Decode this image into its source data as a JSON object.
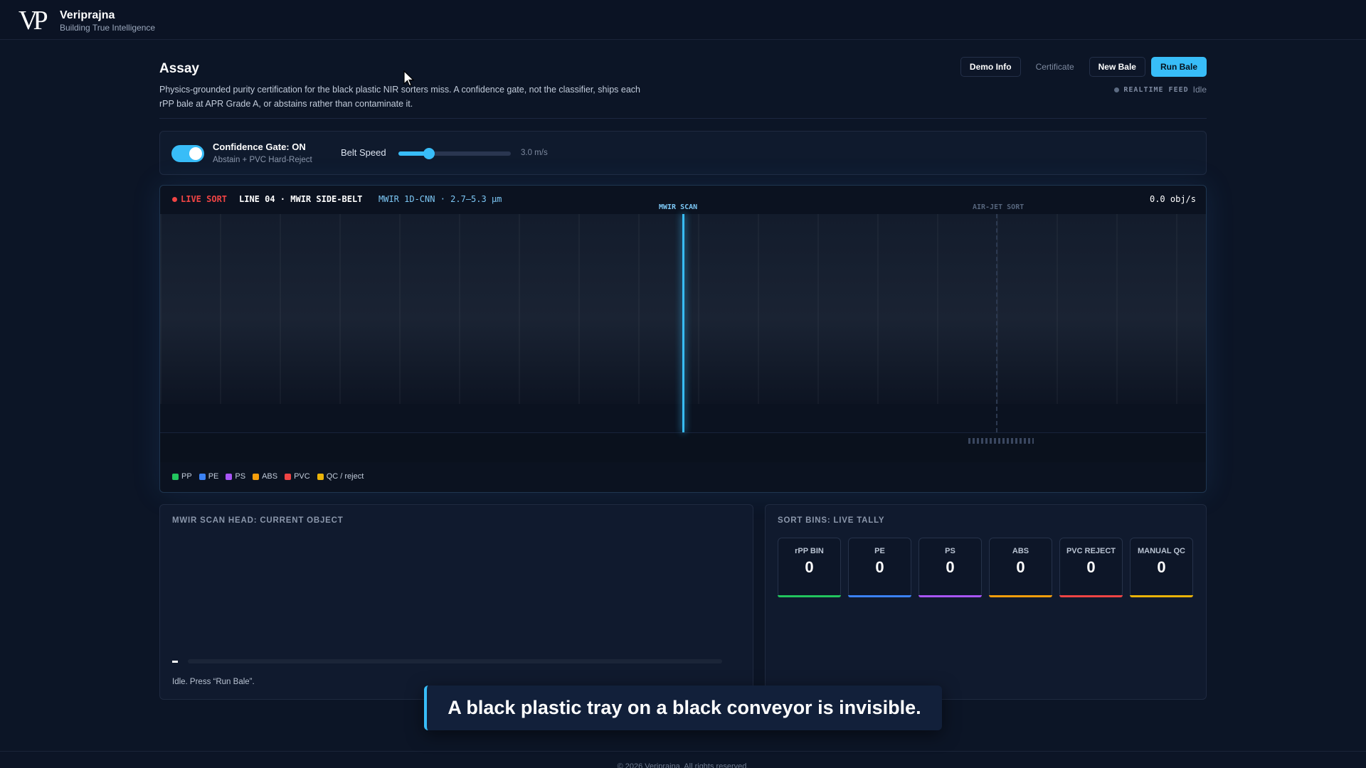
{
  "brand": {
    "logo": "VP",
    "name": "Veriprajna",
    "tagline": "Building True Intelligence"
  },
  "page": {
    "title": "Assay",
    "description": "Physics-grounded purity certification for the black plastic NIR sorters miss. A confidence gate, not the classifier, ships each rPP bale at APR Grade A, or abstains rather than contaminate it."
  },
  "actions": {
    "demo_info": "Demo Info",
    "certificate": "Certificate",
    "new_bale": "New Bale",
    "run_bale": "Run Bale"
  },
  "feed": {
    "label": "REALTIME FEED",
    "status": "Idle"
  },
  "controls": {
    "gate_title": "Confidence Gate: ON",
    "gate_subtitle": "Abstain + PVC Hard-Reject",
    "gate_on": true,
    "speed_label": "Belt Speed",
    "speed_value": "3.0 m/s",
    "speed_fraction": 0.27
  },
  "conveyor": {
    "live_label": "LIVE SORT",
    "line_label": "LINE 04 · MWIR SIDE-BELT",
    "model_label": "MWIR 1D-CNN · 2.7–5.3 µm",
    "rate": "0.0 obj/s",
    "scan_label": "MWIR SCAN",
    "jet_label": "AIR-JET SORT"
  },
  "legend": [
    {
      "label": "PP",
      "color": "#22c55e"
    },
    {
      "label": "PE",
      "color": "#3b82f6"
    },
    {
      "label": "PS",
      "color": "#a855f7"
    },
    {
      "label": "ABS",
      "color": "#f59e0b"
    },
    {
      "label": "PVC",
      "color": "#ef4444"
    },
    {
      "label": "QC / reject",
      "color": "#eab308"
    }
  ],
  "scan_panel": {
    "title": "MWIR SCAN HEAD: CURRENT OBJECT",
    "status": "Idle. Press “Run Bale”."
  },
  "bins_panel": {
    "title": "SORT BINS: LIVE TALLY",
    "bins": [
      {
        "label": "rPP BIN",
        "count": "0",
        "color": "#22c55e"
      },
      {
        "label": "PE",
        "count": "0",
        "color": "#3b82f6"
      },
      {
        "label": "PS",
        "count": "0",
        "color": "#a855f7"
      },
      {
        "label": "ABS",
        "count": "0",
        "color": "#f59e0b"
      },
      {
        "label": "PVC REJECT",
        "count": "0",
        "color": "#ef4444"
      },
      {
        "label": "MANUAL QC",
        "count": "0",
        "color": "#eab308"
      }
    ]
  },
  "caption": "A black plastic tray on a black conveyor is invisible.",
  "footer": "© 2026 Veriprajna. All rights reserved."
}
